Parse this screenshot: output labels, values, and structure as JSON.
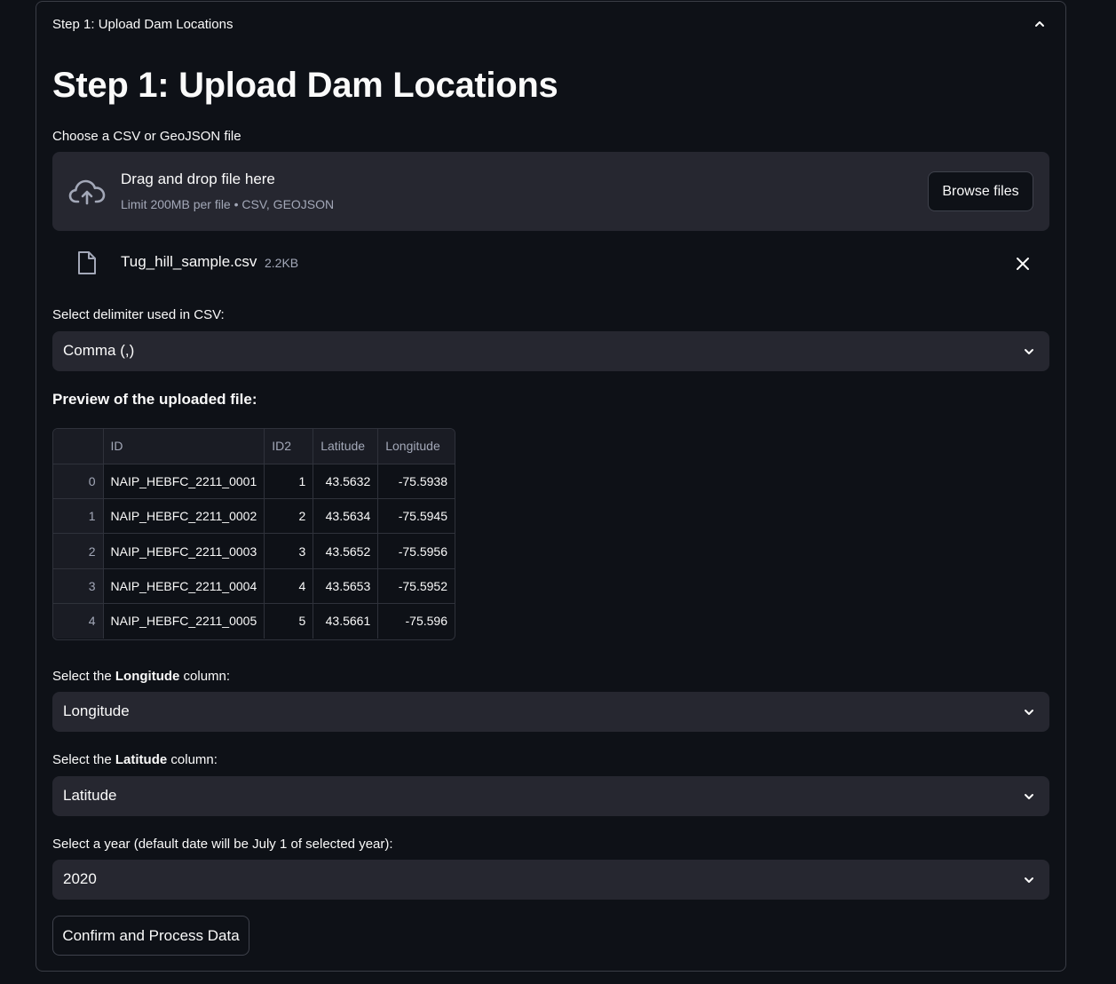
{
  "expander": {
    "header": "Step 1: Upload Dam Locations"
  },
  "page_title": "Step 1: Upload Dam Locations",
  "uploader": {
    "label": "Choose a CSV or GeoJSON file",
    "drop_title": "Drag and drop file here",
    "drop_sub": "Limit 200MB per file • CSV, GEOJSON",
    "browse_label": "Browse files",
    "file_name": "Tug_hill_sample.csv",
    "file_size": "2.2KB"
  },
  "delimiter": {
    "label": "Select delimiter used in CSV:",
    "value": "Comma (,)"
  },
  "preview": {
    "title": "Preview of the uploaded file:",
    "columns": [
      "",
      "ID",
      "ID2",
      "Latitude",
      "Longitude"
    ],
    "rows": [
      [
        "0",
        "NAIP_HEBFC_2211_0001",
        "1",
        "43.5632",
        "-75.5938"
      ],
      [
        "1",
        "NAIP_HEBFC_2211_0002",
        "2",
        "43.5634",
        "-75.5945"
      ],
      [
        "2",
        "NAIP_HEBFC_2211_0003",
        "3",
        "43.5652",
        "-75.5956"
      ],
      [
        "3",
        "NAIP_HEBFC_2211_0004",
        "4",
        "43.5653",
        "-75.5952"
      ],
      [
        "4",
        "NAIP_HEBFC_2211_0005",
        "5",
        "43.5661",
        "-75.596"
      ]
    ]
  },
  "longitude": {
    "label_pre": "Select the ",
    "label_bold": "Longitude",
    "label_post": " column:",
    "value": "Longitude"
  },
  "latitude": {
    "label_pre": "Select the ",
    "label_bold": "Latitude",
    "label_post": " column:",
    "value": "Latitude"
  },
  "year": {
    "label": "Select a year (default date will be July 1 of selected year):",
    "value": "2020"
  },
  "confirm_label": "Confirm and Process Data"
}
